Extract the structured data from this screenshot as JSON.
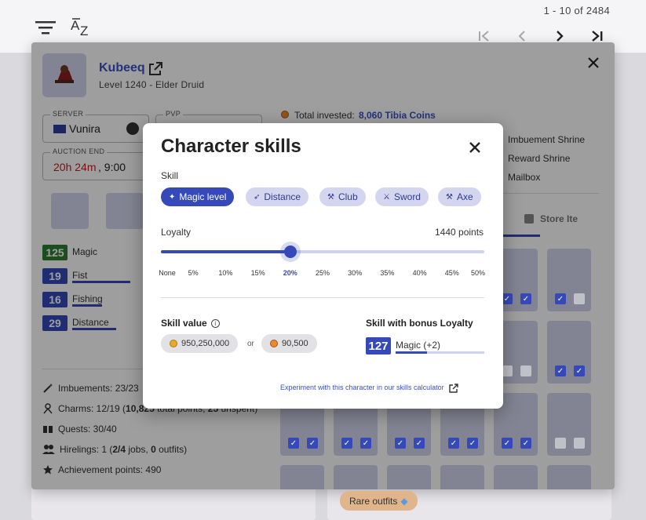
{
  "header": {
    "pagination_text": "1 - 10 of 2484"
  },
  "character": {
    "name": "Kubeeq",
    "level_vocation": "Level 1240 - Elder Druid",
    "server_label": "SERVER",
    "server_value": "Vunira",
    "pvp_label": "PVP",
    "auction_end_label": "AUCTION END",
    "auction_end_time": "20h 24m",
    "auction_end_clock": ", 9:00",
    "total_invested_label": "Total invested:",
    "total_invested_value": "8,060 Tibia Coins",
    "features": [
      "Imbuement Shrine",
      "Reward Shrine",
      "Mailbox"
    ],
    "store_items_tab": "Store Ite",
    "skills": [
      {
        "level": "125",
        "name": "Magic",
        "highlight": true
      },
      {
        "level": "19",
        "name": "Fist"
      },
      {
        "level": "16",
        "name": "Fishing"
      },
      {
        "level": "29",
        "name": "Distance"
      }
    ],
    "imbuements": "Imbuements: 23/23",
    "charms_prefix": "Charms: 12/19 (",
    "charms_points": "10,825",
    "charms_mid": " total points, ",
    "charms_unspent": "25",
    "charms_suffix": " unspent)",
    "quests": "Quests: 30/40",
    "hirelings_prefix": "Hirelings: 1 (",
    "hirelings_jobs": "2/4",
    "hirelings_mid": " jobs, ",
    "hirelings_outfits": "0",
    "hirelings_suffix": " outfits)",
    "achievement_points": "Achievement points: 490",
    "rare_outfits": "Rare outfits"
  },
  "modal": {
    "title": "Character skills",
    "skill_section_label": "Skill",
    "skill_chips": [
      {
        "label": "Magic level",
        "active": true,
        "icon": "magic-icon"
      },
      {
        "label": "Distance",
        "icon": "distance-icon"
      },
      {
        "label": "Club",
        "icon": "club-icon"
      },
      {
        "label": "Sword",
        "icon": "sword-icon"
      },
      {
        "label": "Axe",
        "icon": "axe-icon"
      }
    ],
    "loyalty_label": "Loyalty",
    "loyalty_points": "1440 points",
    "loyalty_level": 0.4,
    "loyalty_ticks": [
      "None",
      "5%",
      "10%",
      "15%",
      "20%",
      "25%",
      "30%",
      "35%",
      "40%",
      "45%",
      "50%"
    ],
    "loyalty_selected": "20%",
    "skill_value_label": "Skill value",
    "gold_value": "950,250,000",
    "or_text": "or",
    "tibia_coins_value": "90,500",
    "bonus_loyalty_label": "Skill with bonus Loyalty",
    "bonus_level": "127",
    "bonus_skill_text": "Magic (+2)",
    "calculator_link": "Experiment with this character in our skills calculator"
  }
}
